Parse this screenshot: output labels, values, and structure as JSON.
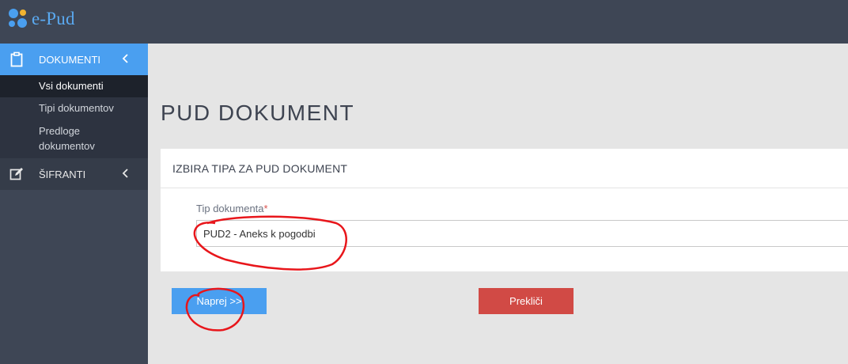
{
  "app": {
    "brand": "e-Pud"
  },
  "sidebar": {
    "sections": [
      {
        "label": "DOKUMENTI",
        "icon": "clipboard-icon",
        "expanded": true,
        "items": [
          {
            "label": "Vsi dokumenti",
            "active": true
          },
          {
            "label": "Tipi dokumentov",
            "active": false
          },
          {
            "label": "Predloge dokumentov",
            "active": false
          }
        ]
      },
      {
        "label": "ŠIFRANTI",
        "icon": "edit-icon",
        "expanded": false
      }
    ]
  },
  "main": {
    "page_title": "PUD DOKUMENT",
    "card": {
      "title": "IZBIRA TIPA ZA PUD DOKUMENT",
      "field": {
        "label": "Tip dokumenta",
        "required_mark": "*",
        "value": "PUD2 - Aneks k pogodbi"
      }
    },
    "buttons": {
      "next": "Naprej >>",
      "cancel": "Prekliči"
    }
  },
  "colors": {
    "header_bg": "#3e4655",
    "accent": "#4a9ff0",
    "danger": "#d14a45",
    "content_bg": "#e5e5e5",
    "annotation": "#e8161b"
  }
}
